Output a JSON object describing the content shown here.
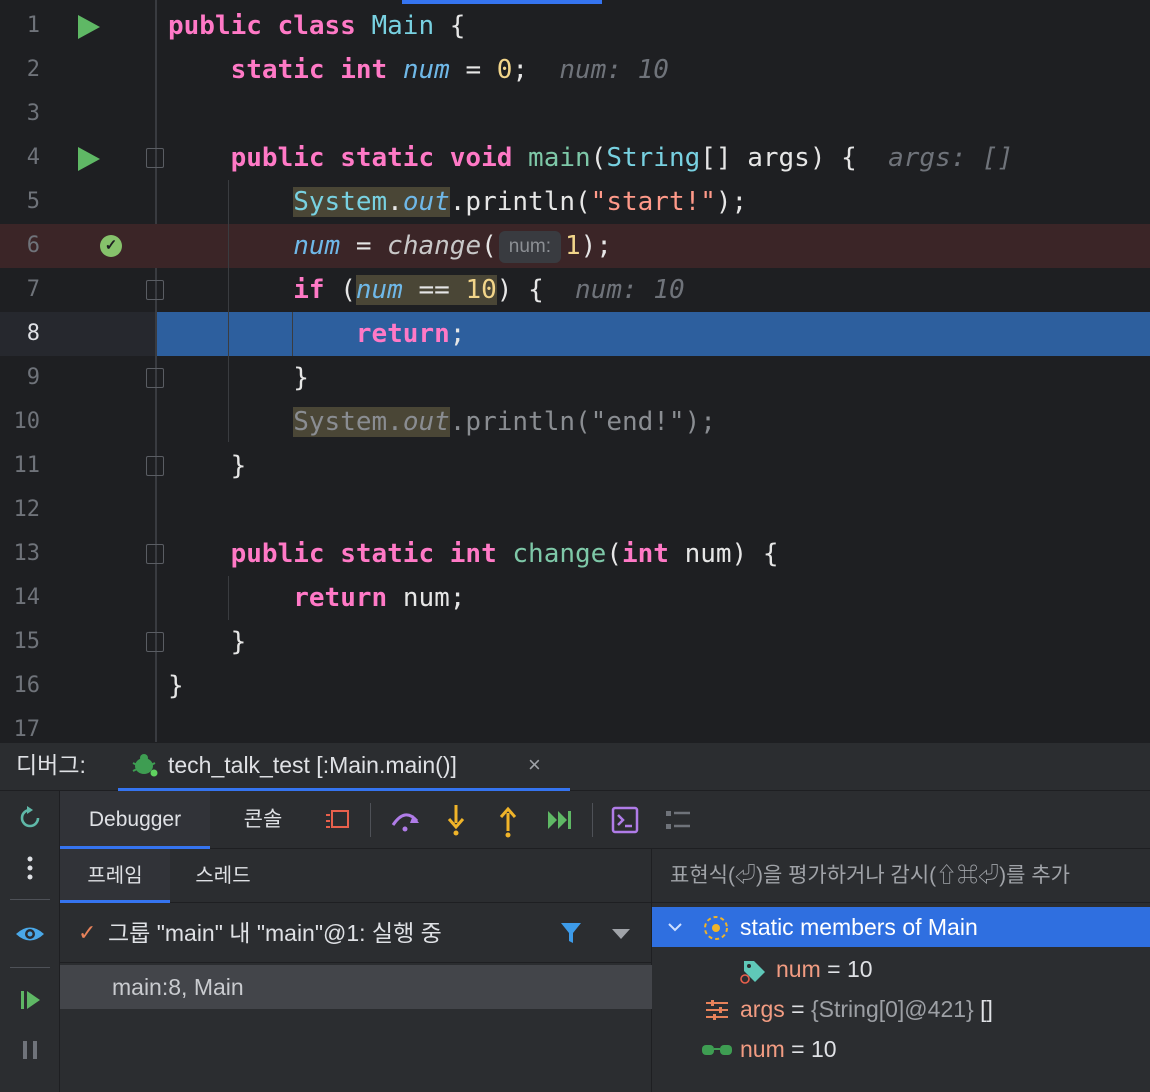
{
  "editor": {
    "lines": [
      {
        "n": "1"
      },
      {
        "n": "2"
      },
      {
        "n": "3"
      },
      {
        "n": "4"
      },
      {
        "n": "5"
      },
      {
        "n": "6"
      },
      {
        "n": "7"
      },
      {
        "n": "8"
      },
      {
        "n": "9"
      },
      {
        "n": "10"
      },
      {
        "n": "11"
      },
      {
        "n": "12"
      },
      {
        "n": "13"
      },
      {
        "n": "14"
      },
      {
        "n": "15"
      },
      {
        "n": "16"
      },
      {
        "n": "17"
      }
    ],
    "code": {
      "l1": [
        "public class",
        "Main",
        "{"
      ],
      "l2": [
        "static int",
        "num",
        "=",
        "0",
        ";",
        "num: 10"
      ],
      "l4": [
        "public static void",
        "main",
        "(",
        "String",
        "[] args) {",
        "args: []"
      ],
      "l5": [
        "System",
        ".",
        "out",
        ".println(",
        "\"start!\"",
        ");"
      ],
      "l6": [
        "num",
        "=",
        "change",
        "(",
        "num:",
        "1",
        ");"
      ],
      "l7": [
        "if",
        "(",
        "num",
        "==",
        "10",
        ") {",
        "num: 10"
      ],
      "l8": [
        "return",
        ";"
      ],
      "l9": [
        "}"
      ],
      "l10": [
        "System",
        ".",
        "out",
        ".println(\"end!\");"
      ],
      "l11": [
        "}"
      ],
      "l13": [
        "public static int",
        "change",
        "(",
        "int",
        "num) {"
      ],
      "l14": [
        "return",
        "num;"
      ],
      "l15": [
        "}"
      ],
      "l16": [
        "}"
      ]
    }
  },
  "debug": {
    "label": "디버그:",
    "session": "tech_talk_test [:Main.main()]",
    "close": "×",
    "tabs": {
      "debugger": "Debugger",
      "console": "콘솔"
    },
    "frames_tabs": {
      "frames": "프레임",
      "threads": "스레드"
    },
    "thread": "그룹 \"main\" 내 \"main\"@1: 실행 중",
    "frame": "main:8, Main",
    "eval_placeholder": "표현식(⏎)을 평가하거나 감시(⇧⌘⏎)를 추가",
    "vars": [
      {
        "name": "static members of Main"
      },
      {
        "name": "num",
        "eq": "=",
        "value": "10"
      },
      {
        "name": "args",
        "eq": "=",
        "value": "{String[0]@421}",
        "extra": "[]"
      },
      {
        "name": "num",
        "eq": "=",
        "value": "10"
      }
    ]
  },
  "colors": {
    "accent": "#3574f0",
    "execution_line": "#2d5f9e",
    "breakpoint_line": "#3b2527",
    "run": "#5fb865"
  }
}
